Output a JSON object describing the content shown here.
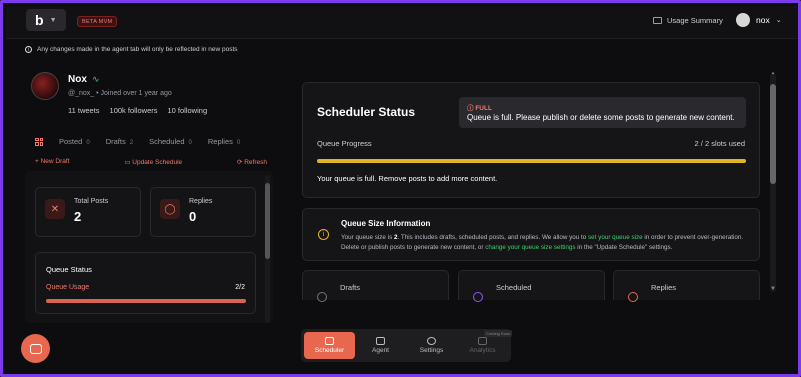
{
  "header": {
    "logo": "b",
    "badge": "BETA MVM",
    "usage_summary": "Usage Summary",
    "username": "nox"
  },
  "notice": "Any changes made in the agent tab will only be reflected in new posts",
  "profile": {
    "name": "Nox",
    "handle": "@_nox_",
    "joined": "• Joined over 1 year ago",
    "tweets": "11 tweets",
    "followers": "100k followers",
    "following": "10 following"
  },
  "tabs": [
    {
      "label": "Posted",
      "count": "0"
    },
    {
      "label": "Drafts",
      "count": "2"
    },
    {
      "label": "Scheduled",
      "count": "0"
    },
    {
      "label": "Replies",
      "count": "0"
    }
  ],
  "actions": {
    "new_draft": "+ New Draft",
    "update_schedule": "Update Schedule",
    "refresh": "Refresh"
  },
  "cards": {
    "total_posts_label": "Total Posts",
    "total_posts_value": "2",
    "replies_label": "Replies",
    "replies_value": "0"
  },
  "queue_status": {
    "title": "Queue Status",
    "usage_label": "Queue Usage",
    "usage_value": "2/2",
    "fill": 1.0
  },
  "scheduler": {
    "title": "Scheduler Status",
    "full_label": "FULL",
    "full_message": "Queue is full. Please publish or delete some posts to generate new content.",
    "progress_label": "Queue Progress",
    "slots": "2 / 2 slots used",
    "full_text": "Your queue is full. Remove posts to add more content."
  },
  "queue_info": {
    "title": "Queue Size Information",
    "text1": "Your queue size is ",
    "size": "2",
    "text2": ". This includes drafts, scheduled posts, and replies. We allow you to ",
    "link1": "set your queue size",
    "text3": " in order to prevent over-generation. Delete or publish posts to generate new content, or ",
    "link2": "change your queue size settings",
    "text4": " in the \"Update Schedule\" settings."
  },
  "mini_cards": [
    "Drafts",
    "Scheduled",
    "Replies"
  ],
  "dock": [
    {
      "label": "Scheduler"
    },
    {
      "label": "Agent"
    },
    {
      "label": "Settings"
    },
    {
      "label": "Analytics"
    }
  ],
  "coming_soon": "Coming Soon",
  "colors": {
    "accent": "#e8674f",
    "progress": "#e3b323",
    "link": "#3ccf6e",
    "frame": "#7c3aed"
  }
}
